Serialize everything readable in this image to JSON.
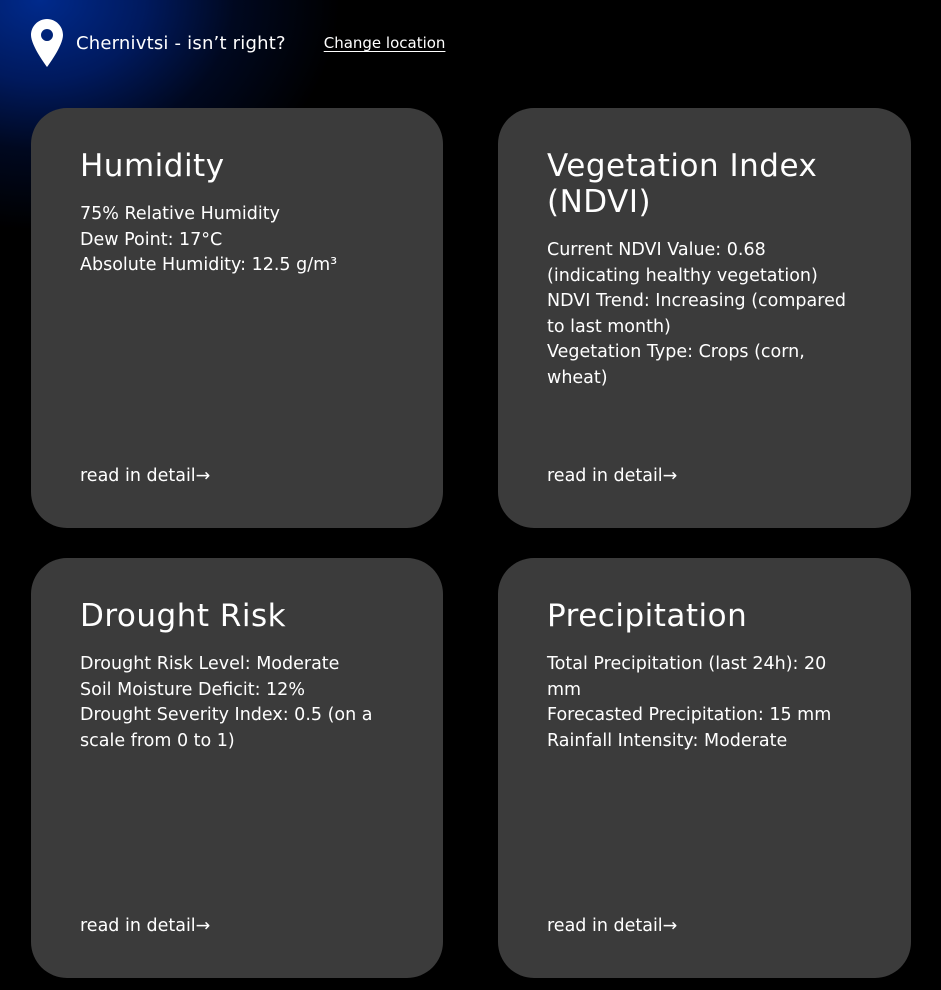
{
  "header": {
    "location_text": "Chernivtsi - isn’t right?",
    "change_location_label": "Change location"
  },
  "cards": [
    {
      "title": "Humidity",
      "lines": [
        "75% Relative Humidity",
        "Dew Point: 17°C",
        "Absolute Humidity: 12.5 g/m³"
      ],
      "link_label": "read in detail→"
    },
    {
      "title": "Vegetation Index (NDVI)",
      "lines": [
        "Current NDVI Value: 0.68 (indicating healthy vegetation)",
        "NDVI Trend: Increasing (compared to last month)",
        "Vegetation Type: Crops (corn, wheat)"
      ],
      "link_label": "read in detail→"
    },
    {
      "title": "Drought Risk",
      "lines": [
        "Drought Risk Level: Moderate",
        "Soil Moisture Deficit: 12%",
        "Drought Severity Index: 0.5 (on a scale from 0 to 1)"
      ],
      "link_label": "read in detail→"
    },
    {
      "title": "Precipitation",
      "lines": [
        "Total Precipitation (last 24h): 20 mm",
        "Forecasted Precipitation: 15 mm",
        "Rainfall Intensity: Moderate"
      ],
      "link_label": "read in detail→"
    }
  ],
  "icons": {
    "location": "map-pin-icon"
  },
  "colors": {
    "background": "#000000",
    "card": "#3b3b3b",
    "gradient_accent": "#002a8c",
    "text": "#ffffff"
  }
}
